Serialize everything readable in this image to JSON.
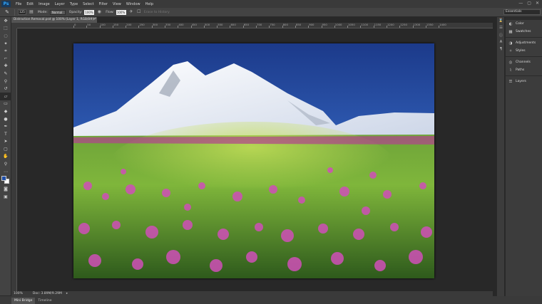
{
  "app": {
    "logo": "Ps"
  },
  "menu": [
    "File",
    "Edit",
    "Image",
    "Layer",
    "Type",
    "Select",
    "Filter",
    "View",
    "Window",
    "Help"
  ],
  "window_controls": [
    "—",
    "▢",
    "✕"
  ],
  "options_bar": {
    "brush_size": "125",
    "mode_label": "Mode:",
    "mode_value": "Normal",
    "opacity_label": "Opacity:",
    "opacity_value": "100%",
    "flow_label": "Flow:",
    "flow_value": "100%",
    "history_label": "Erase to History",
    "workspace": "Essentials"
  },
  "document": {
    "tab_title": "Distraction Removal.psd @ 100% (Layer 1, RGB/8#) *",
    "zoom": "100%",
    "doc_info": "Doc: 3.89M/9.29M"
  },
  "ruler_h": [
    "0",
    "50",
    "100",
    "150",
    "200",
    "250",
    "300",
    "350",
    "400",
    "450",
    "500",
    "550",
    "600",
    "650",
    "700",
    "750",
    "800",
    "850",
    "900",
    "950",
    "1000",
    "1050",
    "1100",
    "1150",
    "1200",
    "1250",
    "1300",
    "1350",
    "1400"
  ],
  "panels": {
    "group1": [
      "Color",
      "Swatches"
    ],
    "group2": [
      "Adjustments",
      "Styles"
    ],
    "group3": [
      "Channels",
      "Paths"
    ],
    "group4": [
      "Layers"
    ]
  },
  "bottom_tabs": [
    "Mini Bridge",
    "Timeline"
  ],
  "colors": {
    "foreground": "#1f4fa8",
    "background": "#ffffff"
  }
}
